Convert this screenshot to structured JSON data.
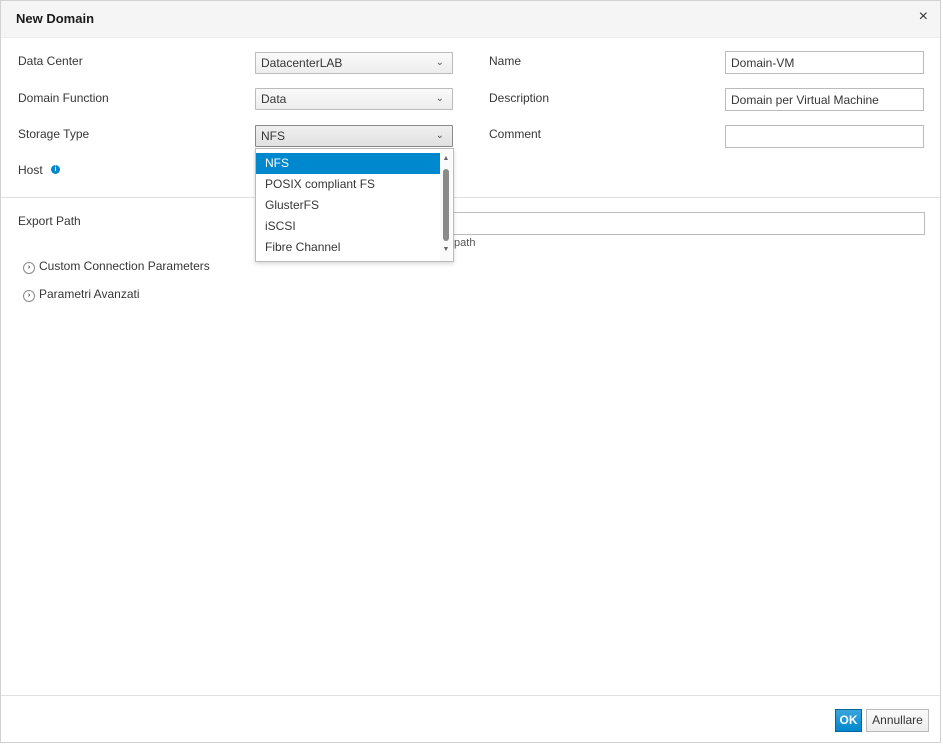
{
  "dialog": {
    "title": "New Domain",
    "close_glyph": "×"
  },
  "form": {
    "data_center": {
      "label": "Data Center",
      "value": "DatacenterLAB"
    },
    "domain_function": {
      "label": "Domain Function",
      "value": "Data"
    },
    "storage_type": {
      "label": "Storage Type",
      "value": "NFS"
    },
    "host": {
      "label": "Host",
      "info_icon": "info-icon"
    },
    "name": {
      "label": "Name",
      "value": "Domain-VM"
    },
    "description": {
      "label": "Description",
      "value": "Domain per Virtual Machine"
    },
    "comment": {
      "label": "Comment",
      "value": ""
    },
    "export_path": {
      "label": "Export Path",
      "value": "",
      "hint_visible": "/path"
    }
  },
  "dropdown": {
    "options": [
      "NFS",
      "POSIX compliant FS",
      "GlusterFS",
      "iSCSI",
      "Fibre Channel"
    ],
    "selected": "NFS",
    "scroll_up": "▲",
    "scroll_down": "▼"
  },
  "expanders": {
    "custom_connection": "Custom Connection Parameters",
    "advanced": "Parametri Avanzati",
    "icon": "›"
  },
  "chevron": "⌄",
  "buttons": {
    "ok": "OK",
    "cancel": "Annullare"
  },
  "colors": {
    "primary": "#0088ce",
    "selected_option": "#0088ce"
  }
}
